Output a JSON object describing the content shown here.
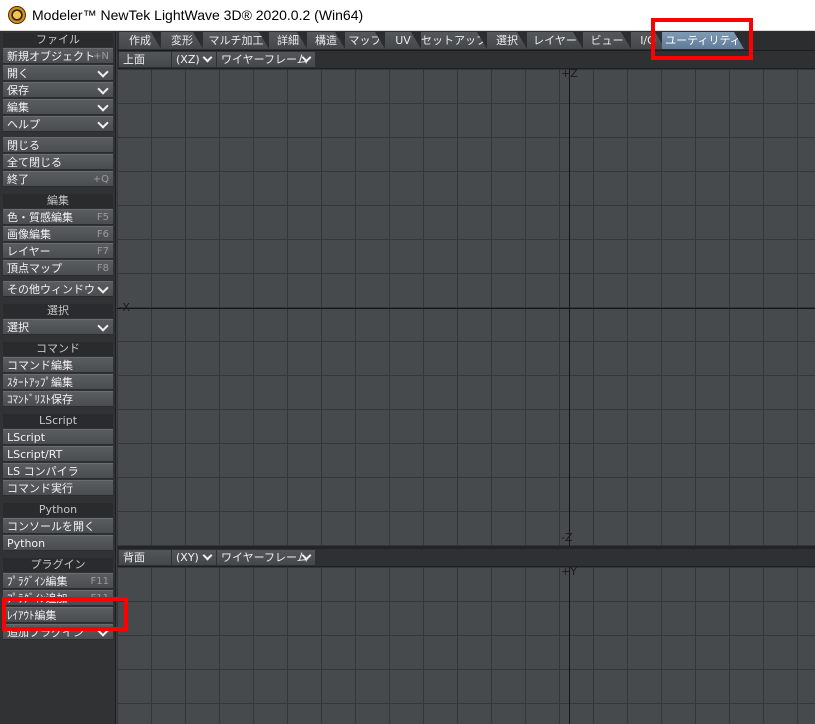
{
  "window": {
    "title": "Modeler™ NewTek LightWave 3D® 2020.0.2 (Win64)"
  },
  "sidebar": {
    "file": {
      "header": "ファイル",
      "items": [
        {
          "label": "新規オブジェクト",
          "key": "+N"
        },
        {
          "label": "開く",
          "dropdown": true
        },
        {
          "label": "保存",
          "dropdown": true
        },
        {
          "label": "編集",
          "dropdown": true
        },
        {
          "label": "ヘルプ",
          "dropdown": true
        }
      ],
      "items2": [
        {
          "label": "閉じる"
        },
        {
          "label": "全て閉じる"
        },
        {
          "label": "終了",
          "key": "+Q"
        }
      ]
    },
    "edit": {
      "header": "編集",
      "items": [
        {
          "label": "色・質感編集",
          "key": "F5"
        },
        {
          "label": "画像編集",
          "key": "F6"
        },
        {
          "label": "レイヤー",
          "key": "F7"
        },
        {
          "label": "頂点マップ",
          "key": "F8"
        }
      ],
      "other_windows": "その他ウィンドウ"
    },
    "select": {
      "header": "選択",
      "item": "選択"
    },
    "command": {
      "header": "コマンド",
      "items": [
        "コマンド編集",
        "ｽﾀｰﾄｱｯﾌﾟ編集",
        "ｺﾏﾝﾄﾞﾘｽﾄ保存"
      ]
    },
    "lscript": {
      "header": "LScript",
      "items": [
        "LScript",
        "LScript/RT",
        "LS コンパイラ",
        "コマンド実行"
      ]
    },
    "python": {
      "header": "Python",
      "items": [
        "コンソールを開く",
        "Python"
      ]
    },
    "plugin": {
      "header": "プラグイン",
      "items": [
        {
          "label": "ﾌﾟﾗｸﾞｲﾝ編集",
          "key": "F11"
        },
        {
          "label": "ﾌﾟﾗｸﾞｲﾝ追加",
          "key": "F11"
        },
        {
          "label": "ﾚｲｱｳﾄ編集",
          "key": ""
        }
      ],
      "extra": "追加プラグイン"
    }
  },
  "tabs": [
    "作成",
    "変形",
    "マルチ加工",
    "詳細",
    "構造",
    "マップ",
    "UV",
    "セットアップ",
    "選択",
    "レイヤー",
    "ビュー",
    "I/O",
    "ユーティリティ"
  ],
  "active_tab": "ユーティリティ",
  "viewports": {
    "top": {
      "view": "上面",
      "plane": "(XZ)",
      "mode": "ワイヤーフレーム",
      "axis_top": "+Z",
      "axis_bottom": "-Z",
      "axis_left": "-X"
    },
    "back": {
      "view": "背面",
      "plane": "(XY)",
      "mode": "ワイヤーフレーム",
      "axis_top": "+Y"
    }
  },
  "colors": {
    "highlight": "#ff0000",
    "active_tab": "#6f8aa7",
    "grid_bg": "#474a4c"
  }
}
